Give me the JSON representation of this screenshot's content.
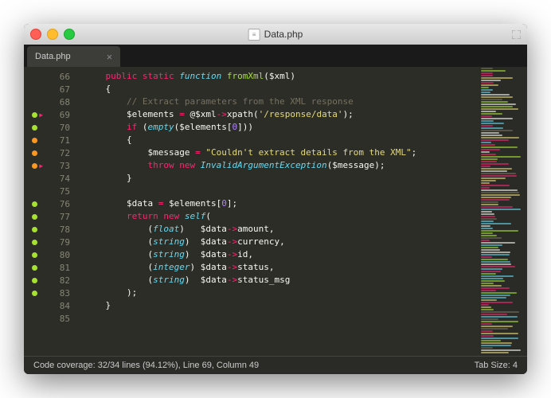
{
  "window": {
    "title": "Data.php"
  },
  "tab": {
    "label": "Data.php",
    "close": "×"
  },
  "lines": [
    {
      "n": "66"
    },
    {
      "n": "67"
    },
    {
      "n": "68"
    },
    {
      "n": "69",
      "dot": "g",
      "arr": true
    },
    {
      "n": "70",
      "dot": "g"
    },
    {
      "n": "71",
      "dot": "o"
    },
    {
      "n": "72",
      "dot": "o"
    },
    {
      "n": "73",
      "dot": "o",
      "arr": true
    },
    {
      "n": "74"
    },
    {
      "n": "75"
    },
    {
      "n": "76",
      "dot": "g"
    },
    {
      "n": "77",
      "dot": "g"
    },
    {
      "n": "78",
      "dot": "g"
    },
    {
      "n": "79",
      "dot": "g"
    },
    {
      "n": "80",
      "dot": "g"
    },
    {
      "n": "81",
      "dot": "g"
    },
    {
      "n": "82",
      "dot": "g"
    },
    {
      "n": "83",
      "dot": "g"
    },
    {
      "n": "84"
    },
    {
      "n": "85"
    }
  ],
  "code": {
    "l66_1": "public",
    "l66_2": "static",
    "l66_3": "function",
    "l66_4": "fromXml",
    "l66_5": "($xml)",
    "l67": "{",
    "l68": "// Extract parameters from the XML response",
    "l69_1": "$elements ",
    "l69_2": "=",
    "l69_3": " @$xml",
    "l69_4": "->",
    "l69_5": "xpath(",
    "l69_6": "'/response/data'",
    "l69_7": ");",
    "l70_1": "if",
    "l70_2": " (",
    "l70_3": "empty",
    "l70_4": "($elements[",
    "l70_5": "0",
    "l70_6": "]))",
    "l71": "{",
    "l72_1": "$message ",
    "l72_2": "=",
    "l72_3": " ",
    "l72_4": "\"Couldn't extract details from the XML\"",
    "l72_5": ";",
    "l73_1": "throw",
    "l73_2": " ",
    "l73_3": "new",
    "l73_4": " ",
    "l73_5": "InvalidArgumentException",
    "l73_6": "($message);",
    "l74": "}",
    "l76_1": "$data ",
    "l76_2": "=",
    "l76_3": " $elements[",
    "l76_4": "0",
    "l76_5": "];",
    "l77_1": "return",
    "l77_2": " ",
    "l77_3": "new",
    "l77_4": " ",
    "l77_5": "self",
    "l77_6": "(",
    "l78_1": "(",
    "l78_2": "float",
    "l78_3": ")   $data",
    "l78_4": "->",
    "l78_5": "amount,",
    "l79_1": "(",
    "l79_2": "string",
    "l79_3": ")  $data",
    "l79_4": "->",
    "l79_5": "currency,",
    "l80_1": "(",
    "l80_2": "string",
    "l80_3": ")  $data",
    "l80_4": "->",
    "l80_5": "id,",
    "l81_1": "(",
    "l81_2": "integer",
    "l81_3": ") $data",
    "l81_4": "->",
    "l81_5": "status,",
    "l82_1": "(",
    "l82_2": "string",
    "l82_3": ")  $data",
    "l82_4": "->",
    "l82_5": "status_msg",
    "l83": ");",
    "l84": "}"
  },
  "status": {
    "left": "Code coverage: 32/34 lines (94.12%), Line 69, Column 49",
    "right": "Tab Size: 4"
  }
}
